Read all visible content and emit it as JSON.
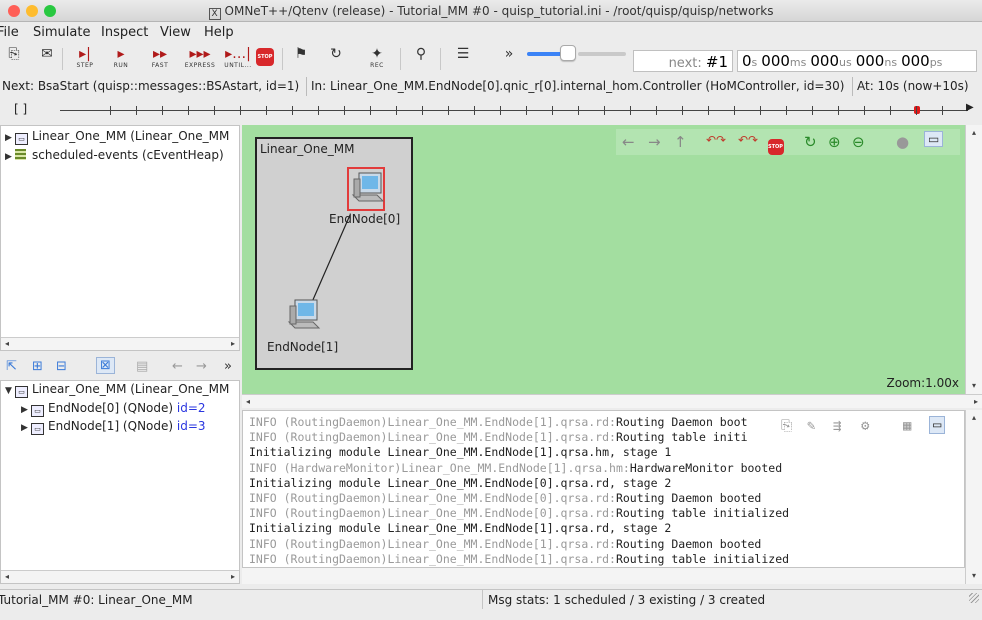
{
  "window": {
    "title": "OMNeT++/Qtenv (release) - Tutorial_MM #0 - quisp_tutorial.ini - /root/quisp/quisp/networks",
    "x_icon": "X",
    "traffic_lights": {
      "close": "#ff5f57",
      "minimize": "#febc2e",
      "maximize": "#28c840"
    }
  },
  "menu": [
    {
      "label": "File"
    },
    {
      "label": "Simulate"
    },
    {
      "label": "Inspect"
    },
    {
      "label": "View"
    },
    {
      "label": "Help"
    }
  ],
  "toolbar": {
    "buttons": [
      {
        "name": "new-run-icon",
        "glyph": "⎘",
        "label": ""
      },
      {
        "name": "load-ned-icon",
        "glyph": "✉",
        "label": ""
      },
      {
        "name": "step-icon",
        "glyph": "▸|",
        "label": "STEP"
      },
      {
        "name": "run-icon",
        "glyph": "▸",
        "label": "RUN"
      },
      {
        "name": "fast-icon",
        "glyph": "▸▸",
        "label": "FAST"
      },
      {
        "name": "express-icon",
        "glyph": "▸▸▸",
        "label": "EXPRESS"
      },
      {
        "name": "until-icon",
        "glyph": "▸…|",
        "label": "UNTIL..."
      },
      {
        "name": "stop-icon",
        "glyph": "STOP",
        "label": ""
      },
      {
        "name": "finish-icon",
        "glyph": "⚑",
        "label": ""
      },
      {
        "name": "rebuild-icon",
        "glyph": "↻",
        "label": ""
      },
      {
        "name": "record-icon",
        "glyph": "✦",
        "label": "REC"
      },
      {
        "name": "find-icon",
        "glyph": "⚲",
        "label": ""
      },
      {
        "name": "timeline-toggle-icon",
        "glyph": "☰",
        "label": ""
      },
      {
        "name": "more-icon",
        "glyph": "»",
        "label": ""
      }
    ],
    "speed_slider_level": 0.45,
    "next_event": {
      "prefix": "next: ",
      "value": "#1"
    },
    "sim_time": [
      {
        "n": "0",
        "u": "s"
      },
      {
        "n": "000",
        "u": "ms"
      },
      {
        "n": "000",
        "u": "us"
      },
      {
        "n": "000",
        "u": "ns"
      },
      {
        "n": "000",
        "u": "ps"
      }
    ]
  },
  "infobar": {
    "next": "Next: BsaStart (quisp::messages::BSAstart, id=1)",
    "in": "In: Linear_One_MM.EndNode[0].qnic_r[0].internal_hom.Controller (HoMController, id=30)",
    "at": "At: 10s (now+10s)"
  },
  "timeline": {
    "brackets": "[    ]",
    "event_marker_color": "#e01818"
  },
  "object_tree": [
    {
      "label": "Linear_One_MM (Linear_One_MM",
      "icon": "module-icon"
    },
    {
      "label": "scheduled-events (cEventHeap)",
      "icon": "heap-icon"
    }
  ],
  "inspector_tree": {
    "root": "Linear_One_MM (Linear_One_MM",
    "children": [
      {
        "label": "EndNode[0] (QNode) ",
        "id": "id=2"
      },
      {
        "label": "EndNode[1] (QNode) ",
        "id": "id=3"
      }
    ]
  },
  "canvas": {
    "background": "#a3dea0",
    "network_name": "Linear_One_MM",
    "nodes": [
      {
        "label": "EndNode[0]",
        "selected": true
      },
      {
        "label": "EndNode[1]",
        "selected": false
      }
    ],
    "zoom": "Zoom:1.00x"
  },
  "log": [
    {
      "gray": "INFO (RoutingDaemon)Linear_One_MM.EndNode[1].qrsa.rd:",
      "text": "Routing Daemon boot"
    },
    {
      "gray": "INFO (RoutingDaemon)Linear_One_MM.EndNode[1].qrsa.rd:",
      "text": "Routing table initi"
    },
    {
      "gray": "",
      "text": "Initializing module Linear_One_MM.EndNode[1].qrsa.hm, stage 1"
    },
    {
      "gray": "INFO (HardwareMonitor)Linear_One_MM.EndNode[1].qrsa.hm:",
      "text": "HardwareMonitor booted"
    },
    {
      "gray": "",
      "text": "Initializing module Linear_One_MM.EndNode[0].qrsa.rd, stage 2"
    },
    {
      "gray": "INFO (RoutingDaemon)Linear_One_MM.EndNode[0].qrsa.rd:",
      "text": "Routing Daemon booted"
    },
    {
      "gray": "INFO (RoutingDaemon)Linear_One_MM.EndNode[0].qrsa.rd:",
      "text": "Routing table initialized"
    },
    {
      "gray": "",
      "text": "Initializing module Linear_One_MM.EndNode[1].qrsa.rd, stage 2"
    },
    {
      "gray": "INFO (RoutingDaemon)Linear_One_MM.EndNode[1].qrsa.rd:",
      "text": "Routing Daemon booted"
    },
    {
      "gray": "INFO (RoutingDaemon)Linear_One_MM.EndNode[1].qrsa.rd:",
      "text": "Routing table initialized"
    }
  ],
  "status": {
    "left": "Tutorial_MM #0: Linear_One_MM",
    "right": "Msg stats: 1 scheduled / 3 existing / 3 created"
  }
}
